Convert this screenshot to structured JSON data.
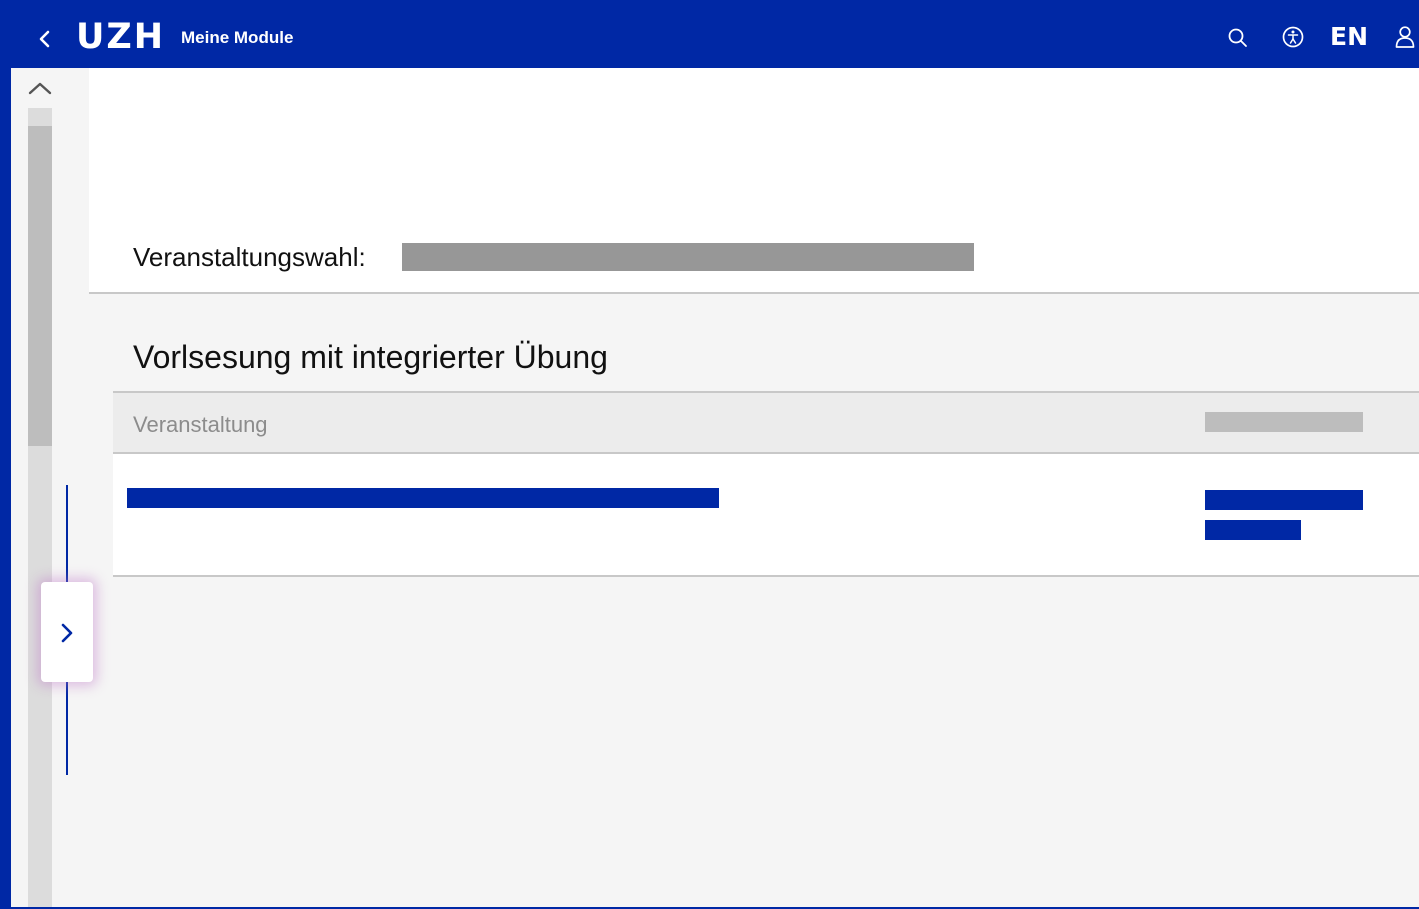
{
  "header": {
    "logo": "UZH",
    "title": "Meine Module",
    "language": "EN",
    "icons": {
      "back": "chevron-left-icon",
      "search": "search-icon",
      "accessibility": "accessibility-icon",
      "user": "user-icon"
    }
  },
  "sidebar": {
    "icons": {
      "scroll_up": "chevron-up-icon",
      "expand": "chevron-right-icon"
    }
  },
  "selection": {
    "label": "Veranstaltungswahl:"
  },
  "section": {
    "title": "Vorlsesung mit integrierter Übung"
  },
  "table": {
    "column_label": "Veranstaltung"
  },
  "colors": {
    "brand": "#0028a5",
    "background": "#f5f5f5",
    "redacted": "#979797"
  }
}
